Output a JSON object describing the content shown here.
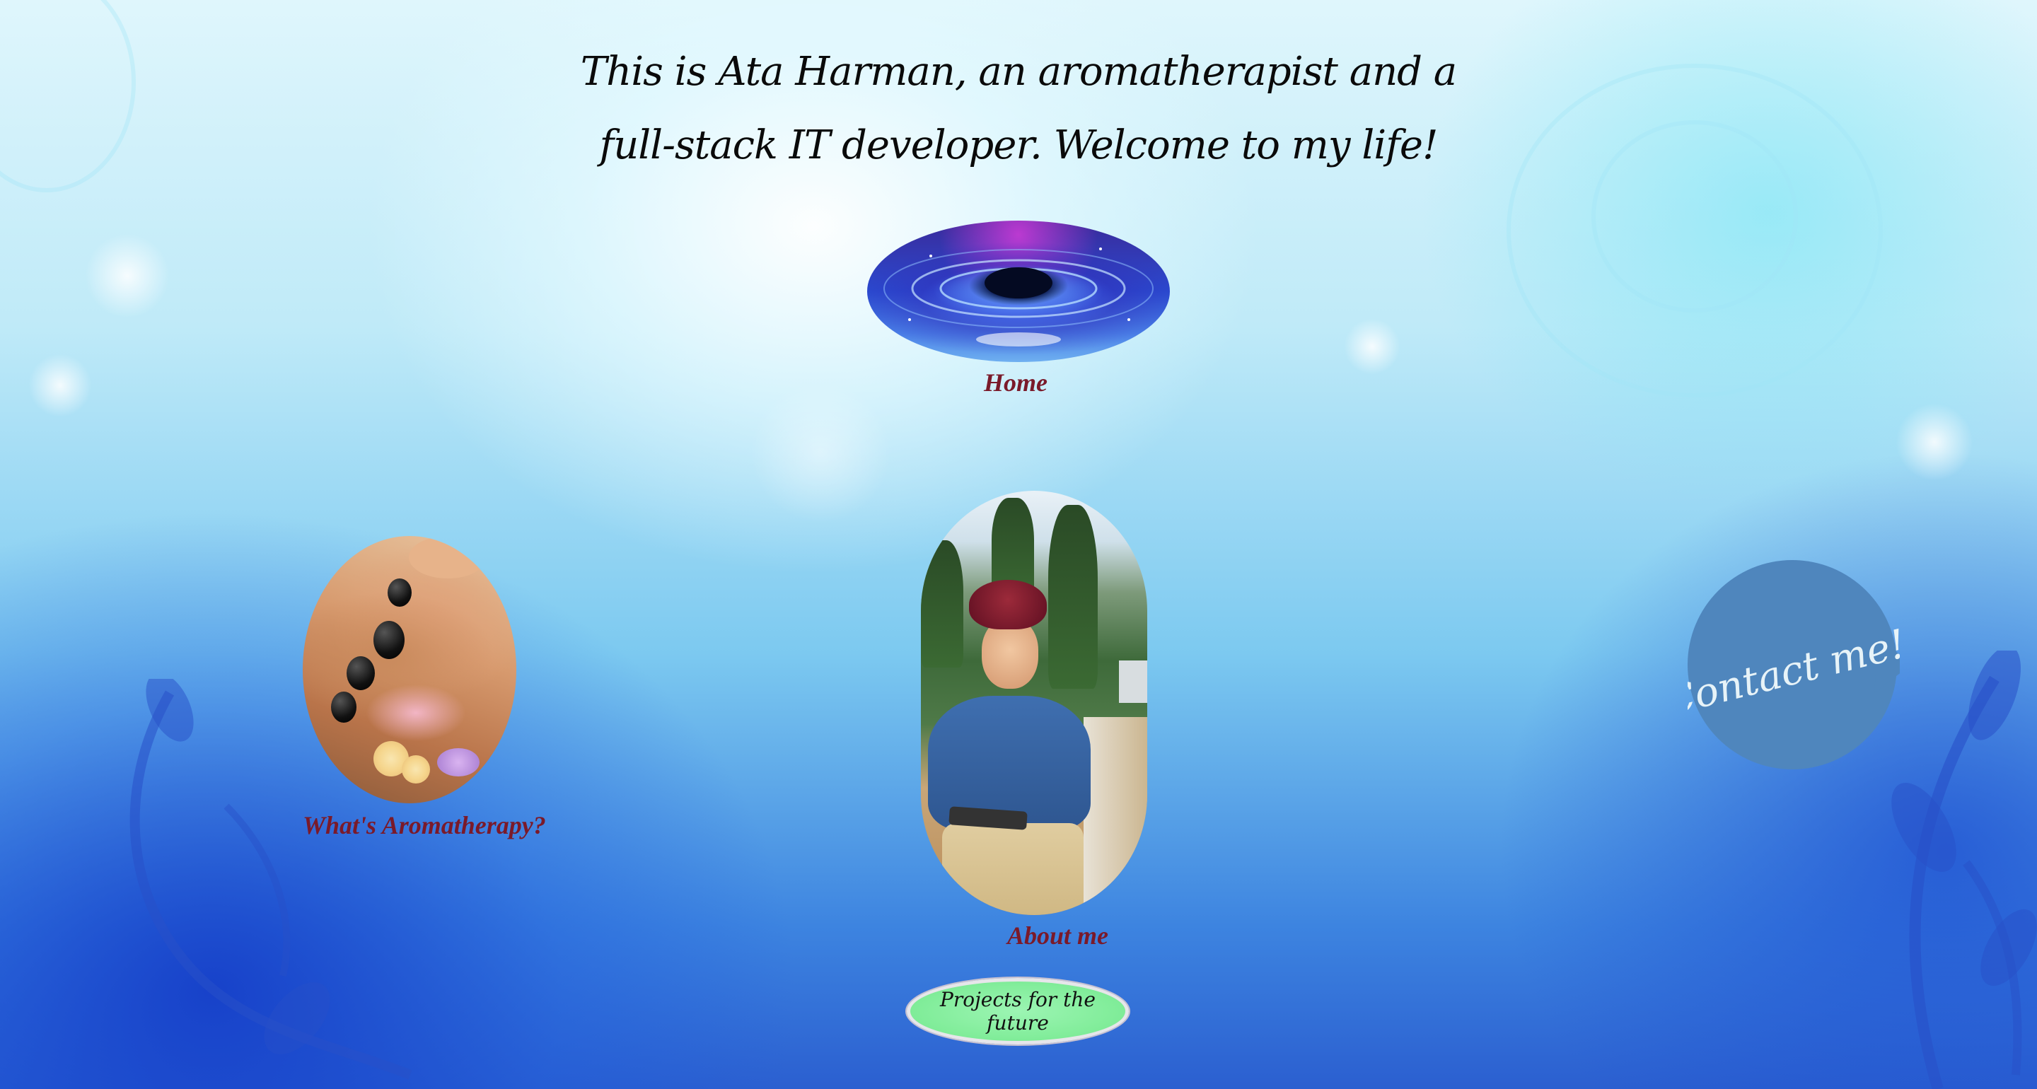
{
  "header": {
    "headline": "This is Ata Harman, an aromatherapist and a full-stack IT developer. Welcome to my life!"
  },
  "nav": {
    "home_label": "Home",
    "aromatherapy_label": "What's Aromatherapy?",
    "about_label": "About me",
    "projects_label": "Projects for the future",
    "contact_label": "Contact me!"
  },
  "colors": {
    "link": "#7a1a2a",
    "projects_button": "#7fec98",
    "contact_bubble": "#4f86bd"
  }
}
